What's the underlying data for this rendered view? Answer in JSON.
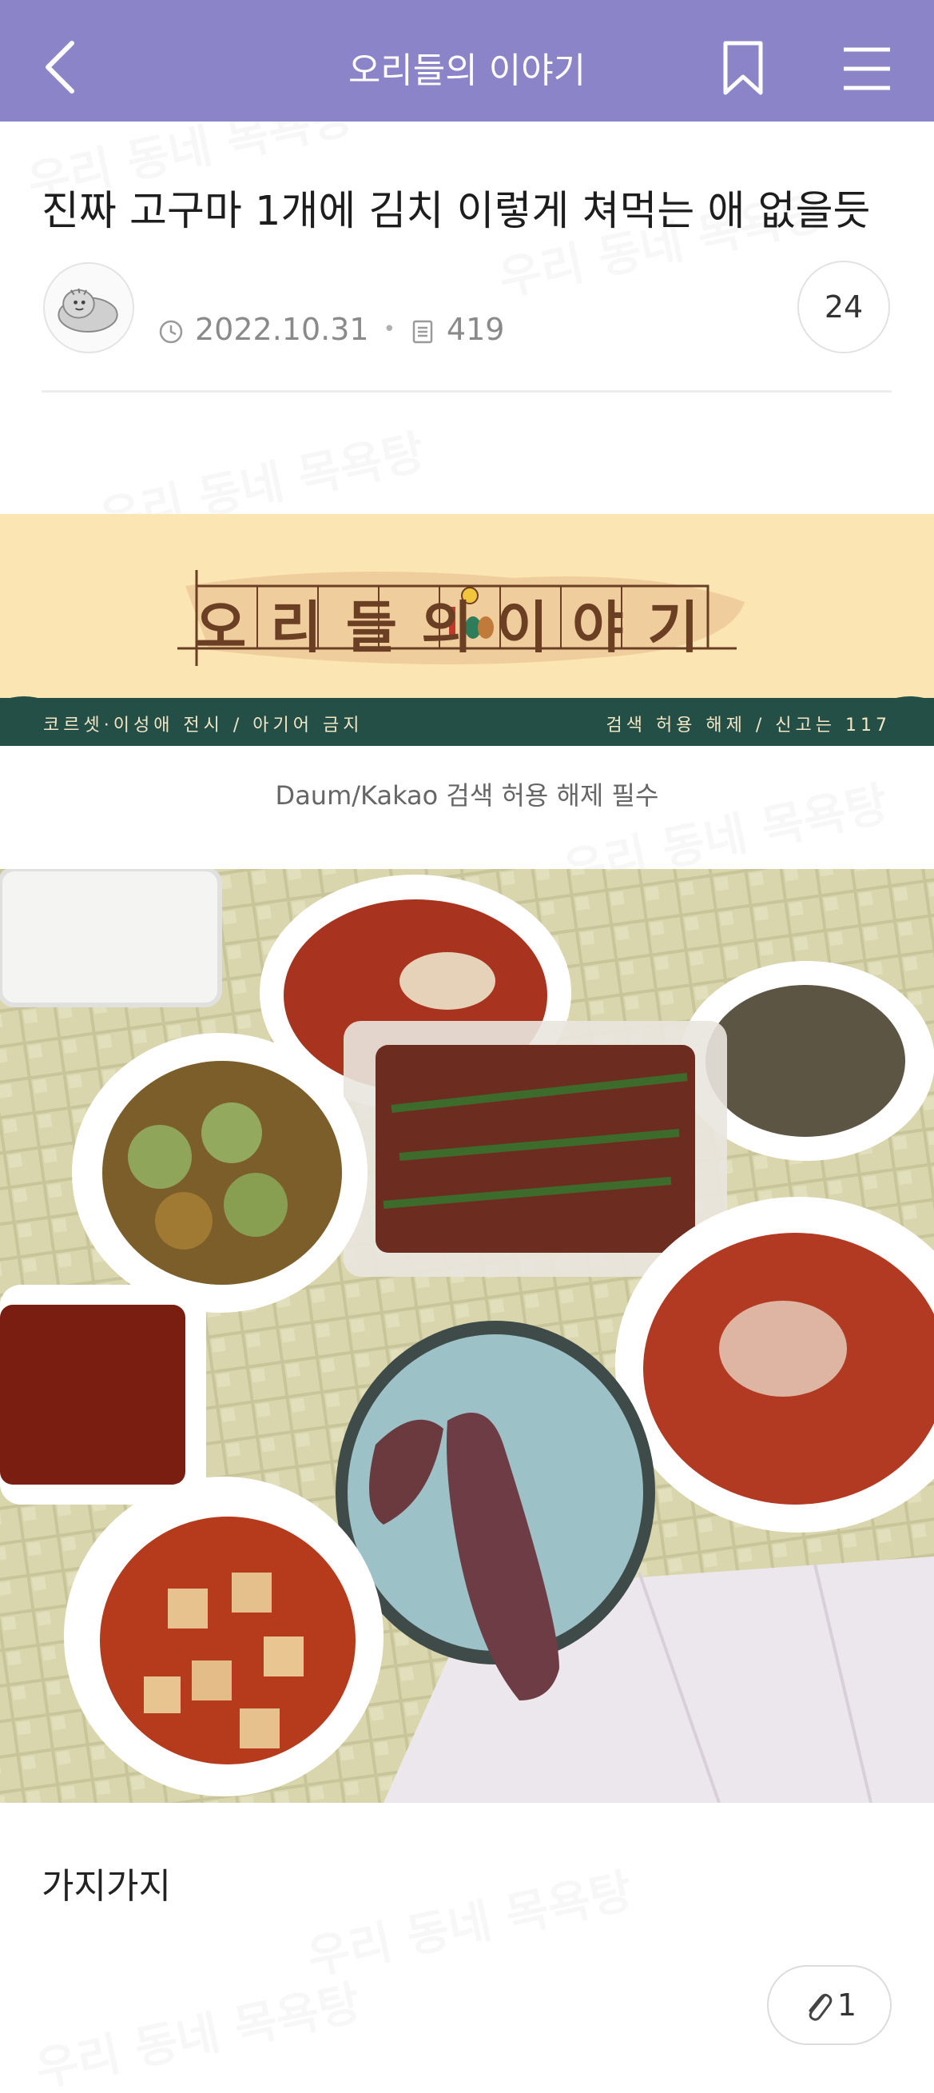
{
  "app_bar": {
    "title": "오리들의 이야기",
    "back_icon": "chevron-left-icon",
    "bookmark_icon": "bookmark-icon",
    "menu_icon": "hamburger-menu-icon",
    "background": "#8b84c9"
  },
  "post": {
    "title": "진짜 고구마 1개에 김치 이렇게 쳐먹는 애 없을듯",
    "date": "2022.10.31",
    "views": "419",
    "comment_count": "24",
    "body_text": "가지가지",
    "attachment_count": "1"
  },
  "banner": {
    "logo_text": "오리들의이야기",
    "left_notice": "코르셋·이성애 전시 / 아기어 금지",
    "right_notice": "검색 허용 해제 / 신고는 117",
    "background": "#fae5b3",
    "strip_color": "#234f47"
  },
  "caption": "Daum/Kakao 검색 허용 해제 필수",
  "watermark_text": "우리 동네 목욕탕"
}
